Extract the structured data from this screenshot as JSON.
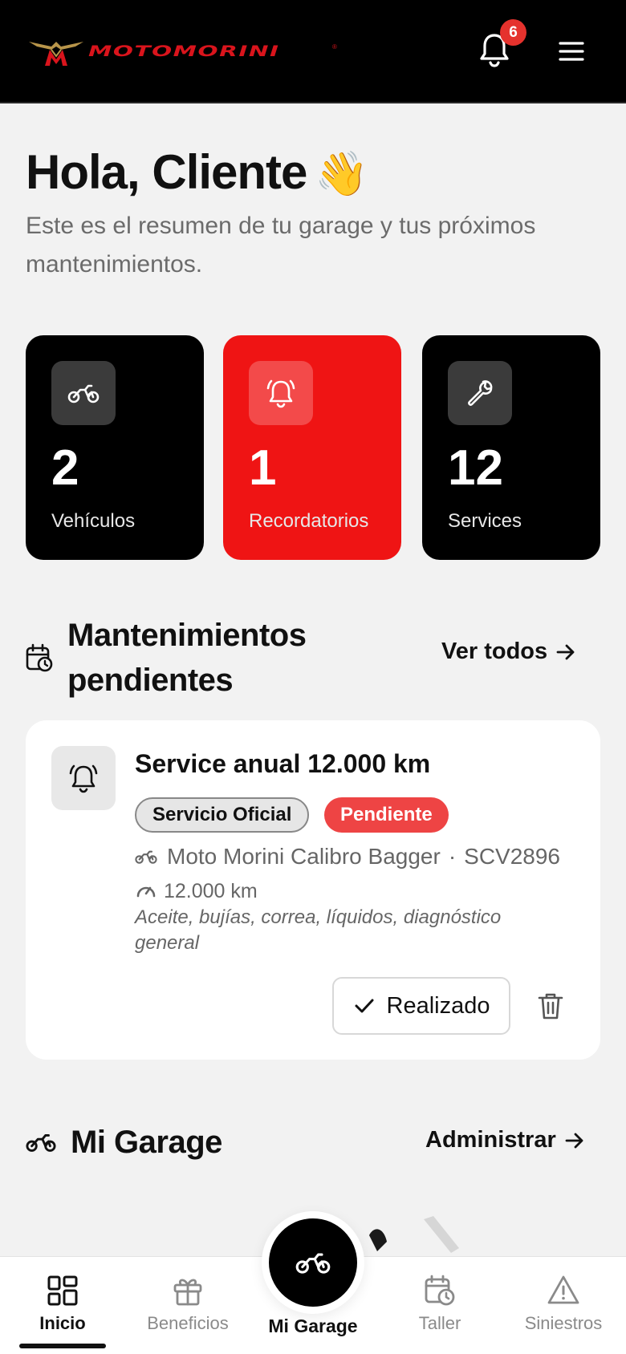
{
  "header": {
    "brand": "MOTOMORINI",
    "brand_reg": "®",
    "notification_count": "6"
  },
  "greeting": {
    "title": "Hola, Cliente",
    "emoji": "👋",
    "subtitle": "Este es el resumen de tu garage y tus próximos mantenimientos."
  },
  "stats": [
    {
      "value": "2",
      "label": "Vehículos",
      "icon": "motorcycle-icon",
      "color": "#000000"
    },
    {
      "value": "1",
      "label": "Recordatorios",
      "icon": "bell-ring-icon",
      "color": "#ef1414"
    },
    {
      "value": "12",
      "label": "Services",
      "icon": "wrench-icon",
      "color": "#000000"
    }
  ],
  "maintenance": {
    "title": "Mantenimientos pendientes",
    "link": "Ver todos",
    "item": {
      "title": "Service anual 12.000 km",
      "type_chip": "Servicio Oficial",
      "status_chip": "Pendiente",
      "vehicle": "Moto Morini Calibro Bagger",
      "separator": "·",
      "plate": "SCV2896",
      "km": "12.000 km",
      "description": "Aceite, bujías, correa, líquidos, diagnóstico general",
      "done_label": "Realizado"
    }
  },
  "garage": {
    "title": "Mi Garage",
    "link": "Administrar"
  },
  "nav": {
    "items": [
      {
        "label": "Inicio",
        "icon": "grid-icon",
        "active": true
      },
      {
        "label": "Beneficios",
        "icon": "gift-icon",
        "active": false
      },
      {
        "label": "Mi Garage",
        "icon": "motorcycle-icon",
        "active": false
      },
      {
        "label": "Taller",
        "icon": "calendar-clock-icon",
        "active": false
      },
      {
        "label": "Siniestros",
        "icon": "warning-icon",
        "active": false
      }
    ]
  },
  "colors": {
    "accent": "#ef1414",
    "badge": "#e5322d",
    "pending": "#ee4444"
  }
}
